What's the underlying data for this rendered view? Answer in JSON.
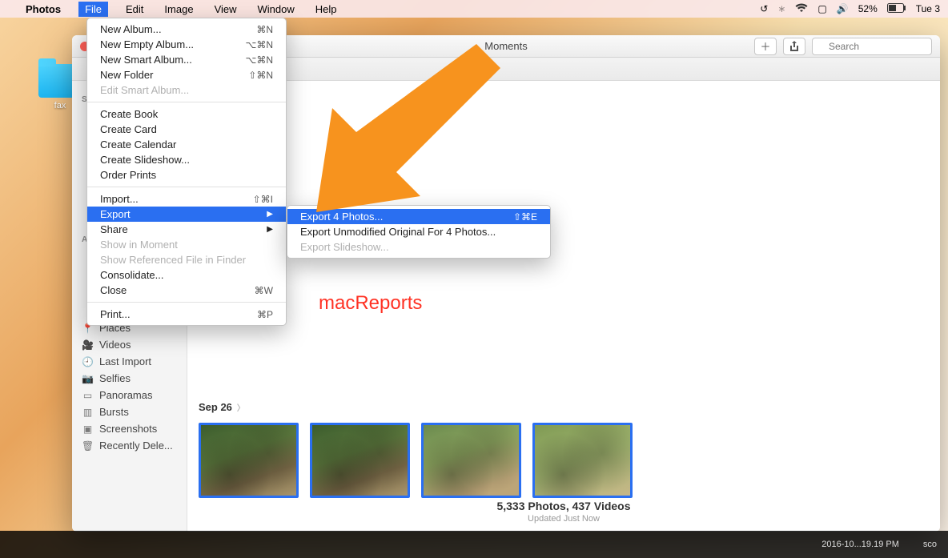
{
  "menubar": {
    "app": "Photos",
    "items": [
      "File",
      "Edit",
      "Image",
      "View",
      "Window",
      "Help"
    ],
    "battery": "52%",
    "clock": "Tue 3"
  },
  "desktop": {
    "folder_label": "fax"
  },
  "window": {
    "title": "Moments",
    "search_placeholder": "Search"
  },
  "sidebar": {
    "hdr1": "Sh",
    "hdr2": "Al",
    "items": [
      "Places",
      "Videos",
      "Last Import",
      "Selfies",
      "Panoramas",
      "Bursts",
      "Screenshots",
      "Recently Dele..."
    ]
  },
  "main": {
    "date": "Sep 26",
    "count_line": "5,333 Photos, 437 Videos",
    "updated_line": "Updated Just Now"
  },
  "file_menu": {
    "g1": [
      {
        "label": "New Album...",
        "sc": "⌘N"
      },
      {
        "label": "New Empty Album...",
        "sc": "⌥⌘N"
      },
      {
        "label": "New Smart Album...",
        "sc": "⌥⌘N"
      },
      {
        "label": "New Folder",
        "sc": "⇧⌘N"
      },
      {
        "label": "Edit Smart Album...",
        "dis": true
      }
    ],
    "g2": [
      {
        "label": "Create Book"
      },
      {
        "label": "Create Card"
      },
      {
        "label": "Create Calendar"
      },
      {
        "label": "Create Slideshow..."
      },
      {
        "label": "Order Prints"
      }
    ],
    "g3": [
      {
        "label": "Import...",
        "sc": "⇧⌘I"
      },
      {
        "label": "Export",
        "sub": true,
        "sel": true
      },
      {
        "label": "Share",
        "sub": true
      },
      {
        "label": "Show in Moment",
        "dis": true
      },
      {
        "label": "Show Referenced File in Finder",
        "dis": true
      },
      {
        "label": "Consolidate..."
      },
      {
        "label": "Close",
        "sc": "⌘W"
      }
    ],
    "g4": [
      {
        "label": "Print...",
        "sc": "⌘P"
      }
    ]
  },
  "export_menu": [
    {
      "label": "Export 4 Photos...",
      "sc": "⇧⌘E",
      "sel": true
    },
    {
      "label": "Export Unmodified Original For 4 Photos..."
    },
    {
      "label": "Export Slideshow...",
      "dis": true
    }
  ],
  "watermark": "macReports",
  "dock": {
    "right1": "2016-10...19.19 PM",
    "right2": "sco"
  }
}
